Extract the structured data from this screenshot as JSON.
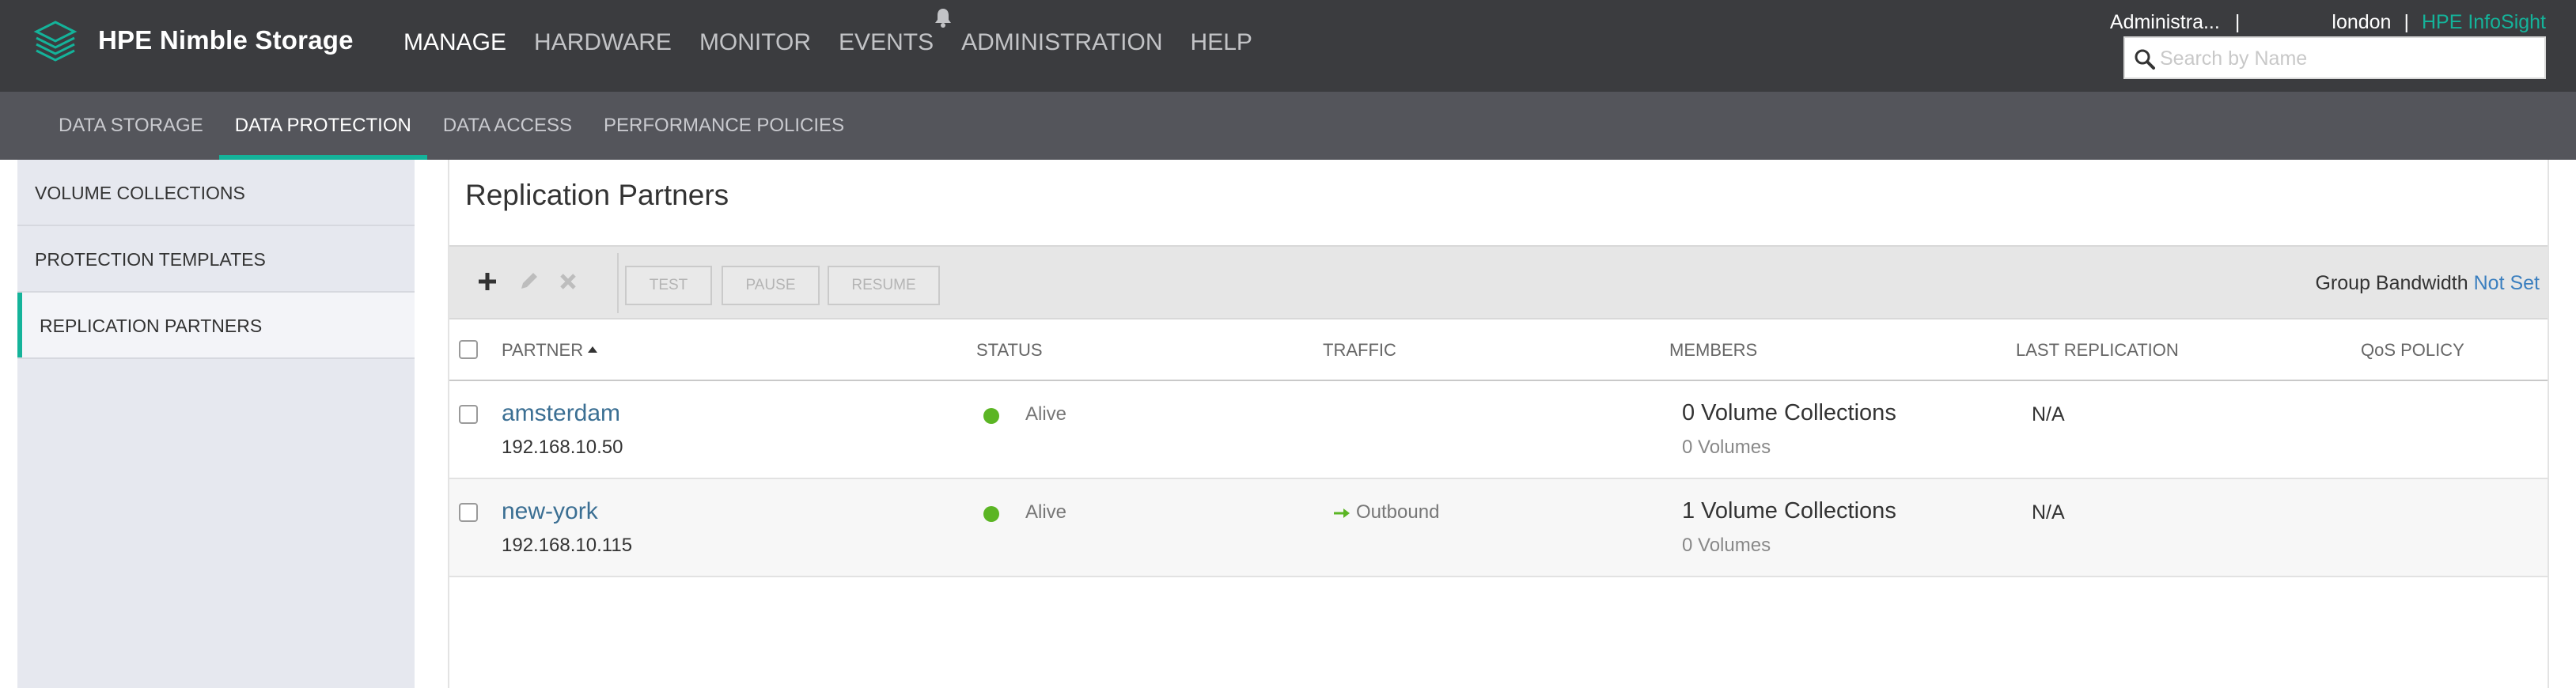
{
  "header": {
    "brand": "HPE Nimble Storage",
    "nav": [
      {
        "label": "MANAGE"
      },
      {
        "label": "HARDWARE"
      },
      {
        "label": "MONITOR"
      },
      {
        "label": "EVENTS"
      },
      {
        "label": "ADMINISTRATION"
      },
      {
        "label": "HELP"
      }
    ],
    "user": "Administra...",
    "separator": "|",
    "array": "london",
    "infosight": "HPE InfoSight",
    "search_placeholder": "Search by Name"
  },
  "subnav": [
    {
      "label": "DATA STORAGE"
    },
    {
      "label": "DATA PROTECTION"
    },
    {
      "label": "DATA ACCESS"
    },
    {
      "label": "PERFORMANCE POLICIES"
    }
  ],
  "sidebar": [
    {
      "label": "VOLUME COLLECTIONS"
    },
    {
      "label": "PROTECTION TEMPLATES"
    },
    {
      "label": "REPLICATION PARTNERS"
    }
  ],
  "main": {
    "title": "Replication Partners",
    "toolbar": {
      "test": "TEST",
      "pause": "PAUSE",
      "resume": "RESUME",
      "bandwidth_label": "Group Bandwidth",
      "bandwidth_value": "Not Set"
    },
    "columns": {
      "partner": "PARTNER",
      "status": "STATUS",
      "traffic": "TRAFFIC",
      "members": "MEMBERS",
      "last_replication": "LAST REPLICATION",
      "qos": "QoS POLICY"
    },
    "rows": [
      {
        "name": "amsterdam",
        "ip": "192.168.10.50",
        "status": "Alive",
        "traffic": "",
        "members": "0 Volume Collections",
        "volumes": "0 Volumes",
        "last_replication": "N/A"
      },
      {
        "name": "new-york",
        "ip": "192.168.10.115",
        "status": "Alive",
        "traffic": "Outbound",
        "members": "1 Volume Collections",
        "volumes": "0 Volumes",
        "last_replication": "N/A"
      }
    ]
  },
  "colors": {
    "accent": "#14b39a",
    "status_alive": "#5bb524",
    "link": "#3b6f93"
  },
  "icons": [
    "logo-icon",
    "bell-icon",
    "search-icon",
    "add-icon",
    "edit-icon",
    "delete-icon",
    "arrow-right-icon",
    "sort-ascending-icon"
  ]
}
